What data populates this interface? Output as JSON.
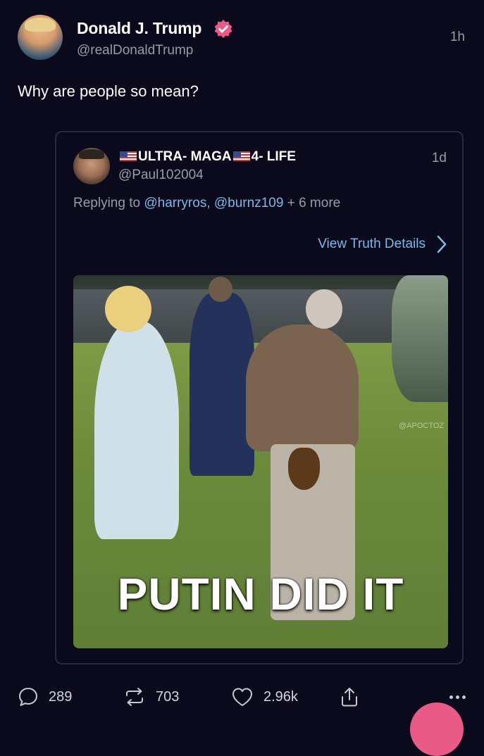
{
  "post": {
    "author_name": "Donald J. Trump",
    "handle": "@realDonaldTrump",
    "time": "1h",
    "text": "Why are people so mean?",
    "verified_icon": "verified-badge-icon"
  },
  "quote": {
    "name_part1": "ULTRA- MAGA",
    "name_part2": "4- LIFE",
    "handle": "@Paul102004",
    "time": "1d",
    "replying_prefix": "Replying to ",
    "mention1": "@harryros",
    "separator": ", ",
    "mention2": "@burnz109",
    "more": " + 6 more",
    "view_details": "View Truth Details",
    "media": {
      "caption": "PUTIN DID IT",
      "watermark": "@APOCTOZ"
    }
  },
  "actions": {
    "replies": "289",
    "retruths": "703",
    "likes": "2.96k"
  },
  "colors": {
    "background": "#0b0a1d",
    "link": "#7fb8e6",
    "verified": "#ea5a86",
    "fab": "#ea5a86"
  }
}
